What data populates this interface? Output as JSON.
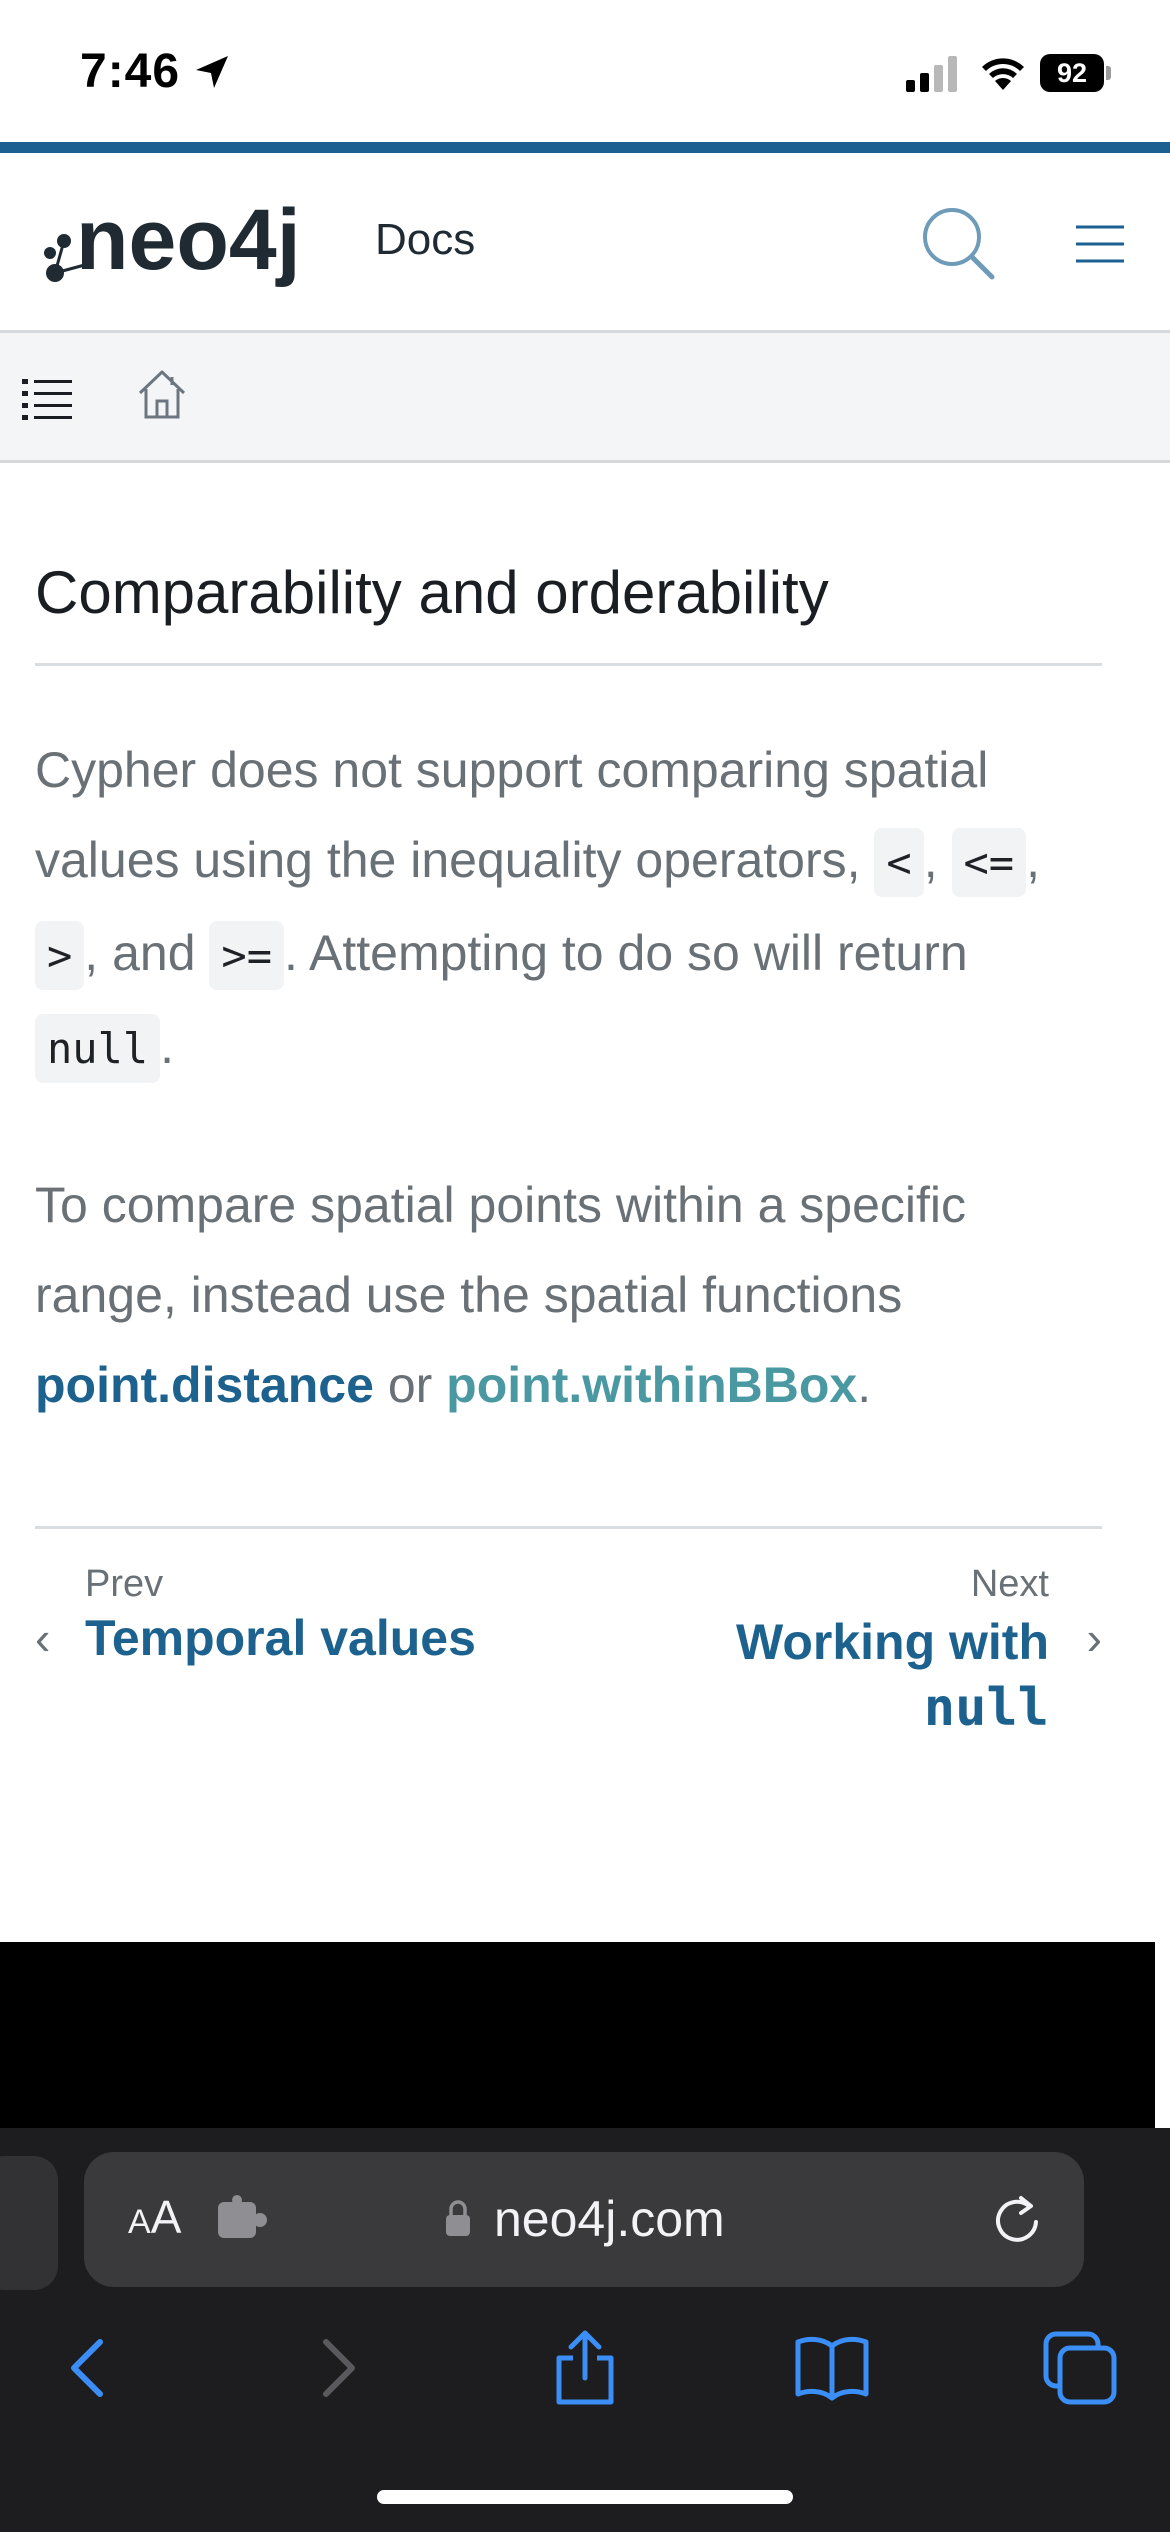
{
  "status_bar": {
    "time": "7:46",
    "battery": "92"
  },
  "header": {
    "logo_text": "neo4j",
    "docs_label": "Docs"
  },
  "content": {
    "title": "Comparability and orderability",
    "para1": {
      "t1": "Cypher does not support comparing spatial values using the inequality operators, ",
      "c1": "<",
      "t2": ", ",
      "c2": "<=",
      "t3": ", ",
      "c3": ">",
      "t4": ", and ",
      "c4": ">=",
      "t5": ". Attempting to do so will return ",
      "c5": "null",
      "t6": "."
    },
    "para2": {
      "t1": "To compare spatial points within a specific range, instead use the spatial functions ",
      "link1": "point.distance",
      "t2": " or ",
      "link2": "point.withinBBox",
      "t3": "."
    },
    "pager": {
      "prev_label": "Prev",
      "prev_title": "Temporal values",
      "next_label": "Next",
      "next_title_text": "Working with",
      "next_title_code": "null"
    }
  },
  "browser": {
    "aa_label_small": "A",
    "aa_label_large": "A",
    "url": "neo4j.com"
  },
  "colors": {
    "accent": "#1b6090",
    "link_dark": "#1d628f",
    "link_teal": "#4a99a2",
    "body_text": "#6a7176",
    "safari_blue": "#3a8ef6"
  }
}
